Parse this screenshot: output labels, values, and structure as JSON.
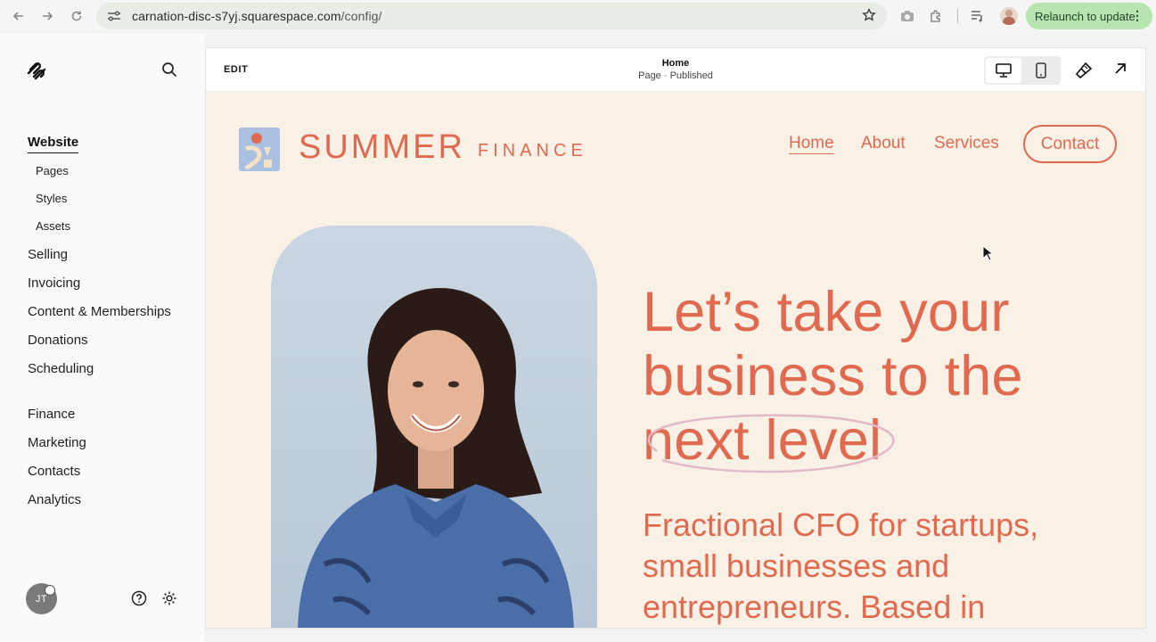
{
  "browser": {
    "url_host": "carnation-disc-s7yj.squarespace.com",
    "url_path": "/config/",
    "relaunch_label": "Relaunch to update"
  },
  "sidebar": {
    "main_items": [
      "Website",
      "Selling",
      "Invoicing",
      "Content & Memberships",
      "Donations",
      "Scheduling"
    ],
    "website_sub_items": [
      "Pages",
      "Styles",
      "Assets"
    ],
    "secondary_items": [
      "Finance",
      "Marketing",
      "Contacts",
      "Analytics"
    ],
    "active_item": "Website",
    "user_initials": "JT"
  },
  "editor": {
    "edit_label": "EDIT",
    "page_title": "Home",
    "page_status": "Page · Published",
    "selected_device": "desktop"
  },
  "site": {
    "brand_primary": "SUMMER",
    "brand_secondary": "FINANCE",
    "nav": [
      "Home",
      "About",
      "Services"
    ],
    "nav_current": "Home",
    "contact_label": "Contact",
    "headline": "Let’s take your business to the next level",
    "subheadline": "Fractional CFO for startups, small businesses and entrepreneurs. Based in",
    "accent_color": "#e06a4f",
    "background_color": "#f9f1e6"
  }
}
